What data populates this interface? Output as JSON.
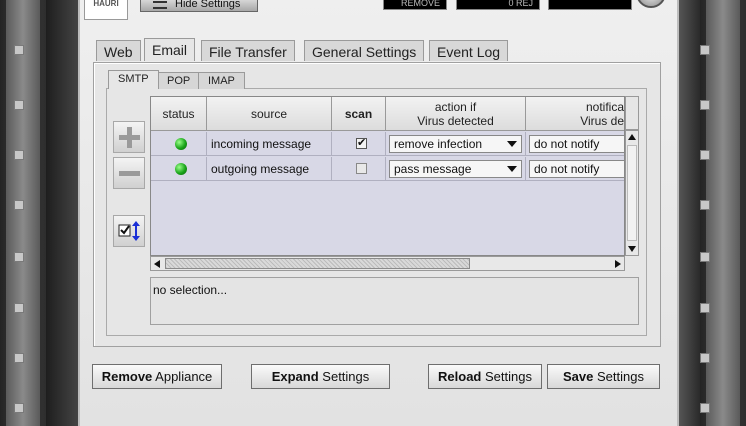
{
  "header": {
    "logo_text": "HAURI",
    "hide_settings_label": "Hide Settings",
    "lcd_left": "REMOVE",
    "lcd_mid": "0 REJ",
    "lcd_right": ""
  },
  "tabs": [
    {
      "label": "Web",
      "active": false
    },
    {
      "label": "Email",
      "active": true
    },
    {
      "label": "File Transfer",
      "active": false
    },
    {
      "label": "General Settings",
      "active": false
    },
    {
      "label": "Event Log",
      "active": false
    }
  ],
  "subtabs": [
    {
      "label": "SMTP",
      "active": true
    },
    {
      "label": "POP",
      "active": false
    },
    {
      "label": "IMAP",
      "active": false
    }
  ],
  "table": {
    "columns": {
      "status": "status",
      "source": "source",
      "scan": "scan",
      "action_line1": "action if",
      "action_line2": "Virus detected",
      "notify_line1": "notifica",
      "notify_line2": "Virus de"
    },
    "rows": [
      {
        "status": "green",
        "source": "incoming message",
        "scan": true,
        "action": "remove infection",
        "notify": "do not notify"
      },
      {
        "status": "green",
        "source": "outgoing message",
        "scan": false,
        "action": "pass message",
        "notify": "do not notify"
      }
    ]
  },
  "detail": {
    "text": "no selection..."
  },
  "buttons": {
    "remove_bold": "Remove",
    "remove_rest": " Appliance",
    "expand_bold": "Expand",
    "expand_rest": " Settings",
    "reload_bold": "Reload",
    "reload_rest": " Settings",
    "save_bold": "Save",
    "save_rest": " Settings"
  },
  "colors": {
    "status_ok": "#1aa51a",
    "table_bg": "#d8d8e6",
    "panel_bg": "#e6e6e6"
  },
  "icons": [
    "plus-icon",
    "minus-icon",
    "check-toggle-icon",
    "hamburger-icon"
  ]
}
